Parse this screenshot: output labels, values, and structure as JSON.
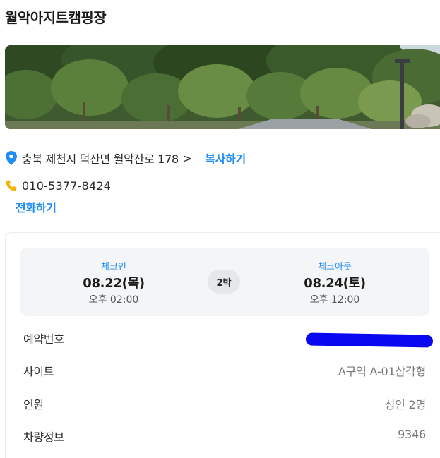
{
  "header": {
    "title": "월악아지트캠핑장"
  },
  "location": {
    "address": "충북 제천시 덕산면 월악산로 178",
    "chevron": ">",
    "copy_label": "복사하기",
    "phone": "010-5377-8424",
    "call_label": "전화하기"
  },
  "stay": {
    "checkin_label": "체크인",
    "checkin_date": "08.22(목)",
    "checkin_time": "오후 02:00",
    "nights": "2박",
    "checkout_label": "체크아웃",
    "checkout_date": "08.24(토)",
    "checkout_time": "오후 12:00"
  },
  "details": [
    {
      "label": "예약번호",
      "value": ""
    },
    {
      "label": "사이트",
      "value": "A구역 A-01삼각형"
    },
    {
      "label": "인원",
      "value": "성인 2명"
    },
    {
      "label": "차량정보",
      "value": "9346"
    }
  ],
  "colors": {
    "accent": "#1f8df5",
    "pin": "#1f8df5",
    "phone_icon": "#f5b400",
    "redaction": "#0a08f0"
  },
  "icons": {
    "location": "location-pin-icon",
    "phone": "phone-icon"
  }
}
